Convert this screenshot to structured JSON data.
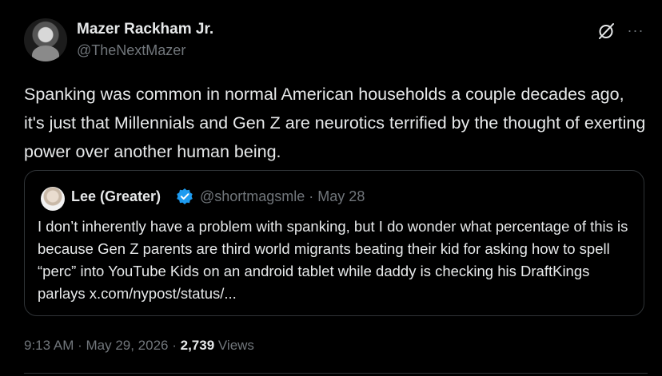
{
  "author": {
    "name": "Mazer Rackham Jr.",
    "handle": "@TheNextMazer"
  },
  "tweet": {
    "text": "Spanking was common in normal American households a couple decades ago, it's just that Millennials and Gen Z are neurotics terrified by the thought of exerting power over another human being."
  },
  "quote": {
    "name": "Lee (Greater)",
    "handle_date": "@shortmagsmle · May 28",
    "text": "I don’t inherently have a problem with spanking, but I do wonder what percentage of this is because Gen Z parents are third world migrants beating their kid for asking how to spell “perc” into YouTube Kids on an android tablet while daddy is checking his DraftKings parlays x.com/nypost/status/..."
  },
  "meta": {
    "time_date": "9:13 AM · May 29, 2026 · ",
    "views_count": "2,739",
    "views_label": " Views"
  },
  "colors": {
    "background": "#000000",
    "text": "#e7e9ea",
    "secondary": "#71767b",
    "border": "#2f3336",
    "verified": "#1d9bf0"
  },
  "icons": {
    "grok": "grok-icon",
    "more": "more-icon",
    "verified": "verified-badge-icon"
  }
}
